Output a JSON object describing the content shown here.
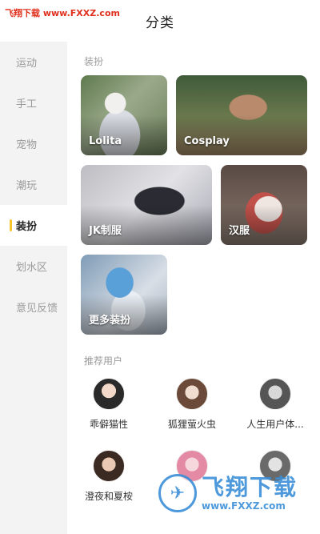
{
  "watermark": {
    "top_text": "飞翔下载 www.FXXZ.com",
    "bottom_cn": "飞翔下载",
    "bottom_url": "www.FXXZ.com"
  },
  "header": {
    "title": "分类"
  },
  "sidebar": {
    "items": [
      {
        "label": "运动"
      },
      {
        "label": "手工"
      },
      {
        "label": "宠物"
      },
      {
        "label": "潮玩"
      },
      {
        "label": "装扮",
        "active": true
      },
      {
        "label": "划水区"
      },
      {
        "label": "意见反馈"
      }
    ]
  },
  "content": {
    "section_title": "装扮",
    "categories": [
      {
        "label": "Lolita"
      },
      {
        "label": "Cosplay"
      },
      {
        "label": "JK制服"
      },
      {
        "label": "汉服"
      },
      {
        "label": "更多装扮"
      }
    ],
    "users_title": "推荐用户",
    "users": [
      {
        "name": "乖僻猫性"
      },
      {
        "name": "狐狸萤火虫"
      },
      {
        "name": "人生用户体..."
      },
      {
        "name": "澄夜和夏桉"
      },
      {
        "name": ""
      },
      {
        "name": ""
      }
    ]
  },
  "colors": {
    "accent": "#f6c62c",
    "sidebar_bg": "#f3f3f3",
    "watermark_red": "#e0301e",
    "watermark_blue": "#3a8fd8"
  }
}
